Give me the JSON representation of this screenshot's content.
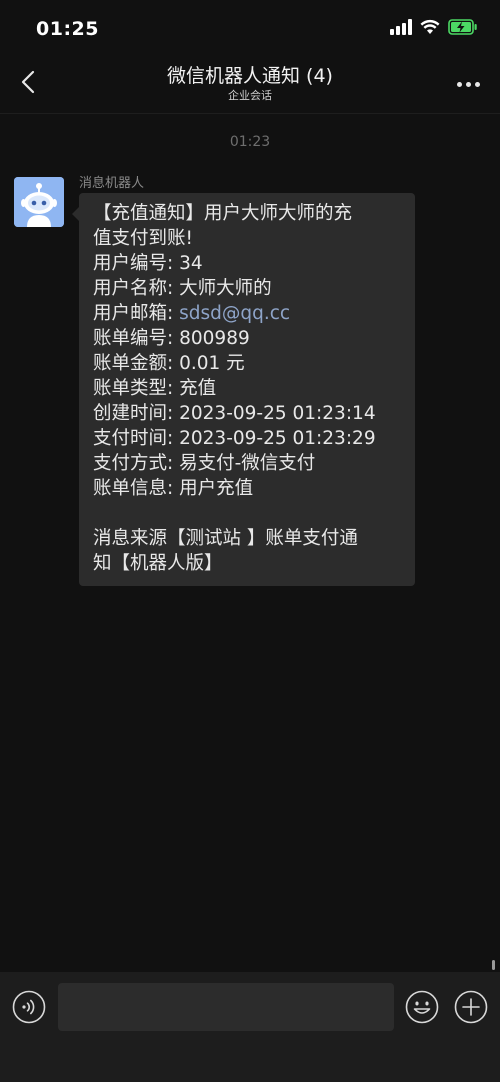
{
  "status_bar": {
    "time": "01:25"
  },
  "header": {
    "title": "微信机器人通知 (4)",
    "subtitle": "企业会话"
  },
  "chat": {
    "timestamp": "01:23",
    "message": {
      "sender": "消息机器人",
      "lines": [
        "【充值通知】用户大师大师的充",
        "值支付到账!",
        "用户编号: 34",
        "用户名称: 大师大师的",
        "账单编号: 800989",
        "账单金额: 0.01 元",
        "账单类型: 充值",
        "创建时间: 2023-09-25 01:23:14",
        "支付时间: 2023-09-25 01:23:29",
        "支付方式: 易支付-微信支付",
        "账单信息: 用户充值",
        "消息来源【测试站 】账单支付通",
        "知【机器人版】"
      ],
      "email_label": "用户邮箱: ",
      "email_value": "sdsd@qq.cc"
    }
  },
  "input_bar": {
    "placeholder": ""
  },
  "colors": {
    "background": "#111111",
    "bubble": "#2c2c2c",
    "email_link": "#8ea4c8",
    "avatar_bg": "#8fb6f2",
    "battery_green": "#4cd964"
  },
  "icons": {
    "back": "chevron-left-icon",
    "more": "more-dots-icon",
    "signal": "signal-icon",
    "wifi": "wifi-icon",
    "battery": "battery-charging-icon",
    "voice": "voice-icon",
    "emoji": "emoji-icon",
    "plus": "plus-icon"
  }
}
